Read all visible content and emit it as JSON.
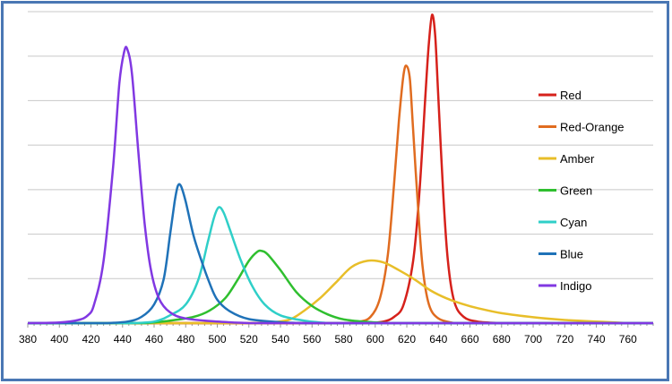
{
  "chart_data": {
    "type": "line",
    "title": "",
    "xlabel": "",
    "ylabel": "",
    "xlim": [
      380,
      776
    ],
    "ylim": [
      0,
      1.0
    ],
    "grid": "horizontal",
    "legend_position": "right",
    "x_ticks": [
      380,
      400,
      420,
      440,
      460,
      480,
      500,
      520,
      540,
      560,
      580,
      600,
      620,
      640,
      660,
      680,
      700,
      720,
      740,
      760
    ],
    "series": [
      {
        "name": "Red",
        "color": "#d6211b",
        "points": [
          [
            595,
            0
          ],
          [
            605,
            0.005
          ],
          [
            612,
            0.02
          ],
          [
            618,
            0.06
          ],
          [
            624,
            0.2
          ],
          [
            628,
            0.42
          ],
          [
            632,
            0.75
          ],
          [
            634,
            0.9
          ],
          [
            636,
            0.99
          ],
          [
            638,
            0.92
          ],
          [
            640,
            0.72
          ],
          [
            643,
            0.42
          ],
          [
            646,
            0.2
          ],
          [
            650,
            0.07
          ],
          [
            656,
            0.02
          ],
          [
            665,
            0.005
          ],
          [
            680,
            0
          ]
        ]
      },
      {
        "name": "Red-Orange",
        "color": "#e06c20",
        "points": [
          [
            580,
            0
          ],
          [
            590,
            0.005
          ],
          [
            597,
            0.02
          ],
          [
            603,
            0.08
          ],
          [
            608,
            0.22
          ],
          [
            612,
            0.45
          ],
          [
            615,
            0.65
          ],
          [
            618,
            0.8
          ],
          [
            620,
            0.825
          ],
          [
            622,
            0.78
          ],
          [
            624,
            0.62
          ],
          [
            627,
            0.38
          ],
          [
            630,
            0.18
          ],
          [
            634,
            0.06
          ],
          [
            640,
            0.015
          ],
          [
            650,
            0
          ]
        ]
      },
      {
        "name": "Amber",
        "color": "#e8be29",
        "points": [
          [
            530,
            0
          ],
          [
            545,
            0.01
          ],
          [
            555,
            0.04
          ],
          [
            565,
            0.08
          ],
          [
            575,
            0.13
          ],
          [
            585,
            0.18
          ],
          [
            595,
            0.2
          ],
          [
            605,
            0.195
          ],
          [
            615,
            0.17
          ],
          [
            625,
            0.14
          ],
          [
            635,
            0.105
          ],
          [
            645,
            0.08
          ],
          [
            655,
            0.062
          ],
          [
            665,
            0.048
          ],
          [
            680,
            0.032
          ],
          [
            700,
            0.019
          ],
          [
            720,
            0.01
          ],
          [
            745,
            0.004
          ],
          [
            760,
            0
          ]
        ]
      },
      {
        "name": "Green",
        "color": "#2fbf2f",
        "points": [
          [
            455,
            0
          ],
          [
            470,
            0.008
          ],
          [
            485,
            0.02
          ],
          [
            495,
            0.04
          ],
          [
            505,
            0.08
          ],
          [
            513,
            0.14
          ],
          [
            520,
            0.2
          ],
          [
            525,
            0.228
          ],
          [
            528,
            0.232
          ],
          [
            532,
            0.22
          ],
          [
            540,
            0.17
          ],
          [
            550,
            0.1
          ],
          [
            560,
            0.055
          ],
          [
            570,
            0.028
          ],
          [
            580,
            0.012
          ],
          [
            595,
            0.004
          ],
          [
            610,
            0
          ]
        ]
      },
      {
        "name": "Cyan",
        "color": "#2fcfc8",
        "points": [
          [
            445,
            0
          ],
          [
            460,
            0.005
          ],
          [
            470,
            0.025
          ],
          [
            480,
            0.06
          ],
          [
            488,
            0.14
          ],
          [
            494,
            0.26
          ],
          [
            498,
            0.34
          ],
          [
            501,
            0.372
          ],
          [
            504,
            0.355
          ],
          [
            508,
            0.3
          ],
          [
            515,
            0.2
          ],
          [
            522,
            0.12
          ],
          [
            530,
            0.06
          ],
          [
            540,
            0.025
          ],
          [
            555,
            0.008
          ],
          [
            570,
            0
          ]
        ]
      },
      {
        "name": "Blue",
        "color": "#1f72b8",
        "points": [
          [
            430,
            0
          ],
          [
            443,
            0.005
          ],
          [
            452,
            0.02
          ],
          [
            460,
            0.06
          ],
          [
            466,
            0.14
          ],
          [
            470,
            0.28
          ],
          [
            473,
            0.39
          ],
          [
            475,
            0.44
          ],
          [
            477,
            0.44
          ],
          [
            480,
            0.39
          ],
          [
            485,
            0.28
          ],
          [
            490,
            0.2
          ],
          [
            495,
            0.13
          ],
          [
            500,
            0.075
          ],
          [
            508,
            0.038
          ],
          [
            520,
            0.013
          ],
          [
            540,
            0.003
          ],
          [
            555,
            0
          ]
        ]
      },
      {
        "name": "Indigo",
        "color": "#8138e2",
        "points": [
          [
            380,
            0
          ],
          [
            400,
            0.002
          ],
          [
            412,
            0.01
          ],
          [
            418,
            0.025
          ],
          [
            422,
            0.06
          ],
          [
            428,
            0.2
          ],
          [
            434,
            0.5
          ],
          [
            438,
            0.77
          ],
          [
            441,
            0.87
          ],
          [
            443,
            0.88
          ],
          [
            446,
            0.8
          ],
          [
            450,
            0.55
          ],
          [
            454,
            0.32
          ],
          [
            458,
            0.17
          ],
          [
            463,
            0.08
          ],
          [
            470,
            0.035
          ],
          [
            480,
            0.015
          ],
          [
            500,
            0.005
          ],
          [
            520,
            0
          ]
        ]
      }
    ]
  }
}
